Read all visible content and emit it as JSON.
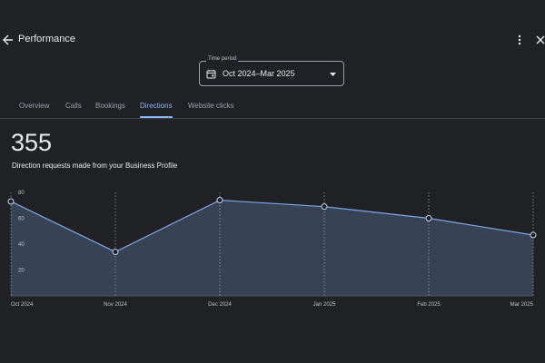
{
  "header": {
    "title": "Performance"
  },
  "time_period": {
    "label": "Time period",
    "value": "Oct 2024–Mar 2025"
  },
  "tabs": [
    {
      "label": "Overview",
      "active": false
    },
    {
      "label": "Calls",
      "active": false
    },
    {
      "label": "Bookings",
      "active": false
    },
    {
      "label": "Directions",
      "active": true
    },
    {
      "label": "Website clicks",
      "active": false
    }
  ],
  "summary": {
    "total": "355",
    "description": "Direction requests made from your Business Profile"
  },
  "colors": {
    "accent": "#8ab4f8",
    "line": "#7fa6e4",
    "area": "#3a4558",
    "background": "#202124"
  },
  "chart_data": {
    "type": "area",
    "categories": [
      "Oct 2024",
      "Nov 2024",
      "Dec 2024",
      "Jan 2025",
      "Feb 2025",
      "Mar 2025"
    ],
    "values": [
      73,
      34,
      74,
      69,
      60,
      47
    ],
    "y_ticks": [
      "20",
      "40",
      "60",
      "80"
    ],
    "ylim": [
      0,
      80
    ],
    "grid": "vertical dotted"
  }
}
